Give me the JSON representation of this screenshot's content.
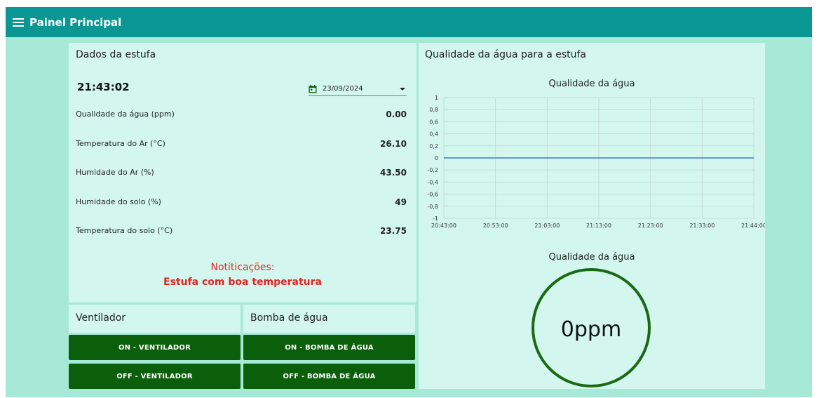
{
  "header": {
    "title": "Painel Principal",
    "menu_icon": "hamburger-menu-icon"
  },
  "greenhouse": {
    "title": "Dados da estufa",
    "time": "21:43:02",
    "date": "23/09/2024",
    "rows": [
      {
        "label": "Qualidade da água (ppm)",
        "value": "0.00"
      },
      {
        "label": "Temperatura do Ar (°C)",
        "value": "26.10"
      },
      {
        "label": "Humidade do Ar (%)",
        "value": "43.50"
      },
      {
        "label": "Humidade do solo (%)",
        "value": "49"
      },
      {
        "label": "Temperatura do solo (°C)",
        "value": "23.75"
      }
    ],
    "notification_title": "Notiticações:",
    "notification_message": "Estufa com boa temperatura"
  },
  "fan": {
    "title": "Ventilador",
    "on_label": "ON - VENTILADOR",
    "off_label": "OFF - VENTILADOR"
  },
  "pump": {
    "title": "Bomba de água",
    "on_label": "ON - BOMBA DE ÁGUA",
    "off_label": "OFF - BOMBA DE ÁGUA"
  },
  "water_panel": {
    "title": "Qualidade da água para a estufa",
    "gauge_title": "Qualidade da água",
    "gauge_value": "0ppm"
  },
  "colors": {
    "header": "#0a9692",
    "background": "#a6e9d6",
    "panel": "#d3f7ee",
    "button": "#0b5e0a",
    "notification": "#e52222",
    "line": "#3a7bd5",
    "gauge_ring": "#1a6a14"
  },
  "chart_data": {
    "type": "line",
    "title": "Qualidade da água",
    "x": [
      "20:43:00",
      "20:53:00",
      "21:03:00",
      "21:13:00",
      "21:23:00",
      "21:33:00",
      "21:44:00"
    ],
    "series": [
      {
        "values": [
          0,
          0,
          0,
          0,
          0,
          0,
          0
        ]
      }
    ],
    "y_ticks": [
      "1",
      "0,8",
      "0,6",
      "0,4",
      "0,2",
      "0",
      "-0,2",
      "-0,4",
      "-0,6",
      "-0,8",
      "-1"
    ],
    "ylim": [
      -1,
      1
    ],
    "grid": true
  }
}
